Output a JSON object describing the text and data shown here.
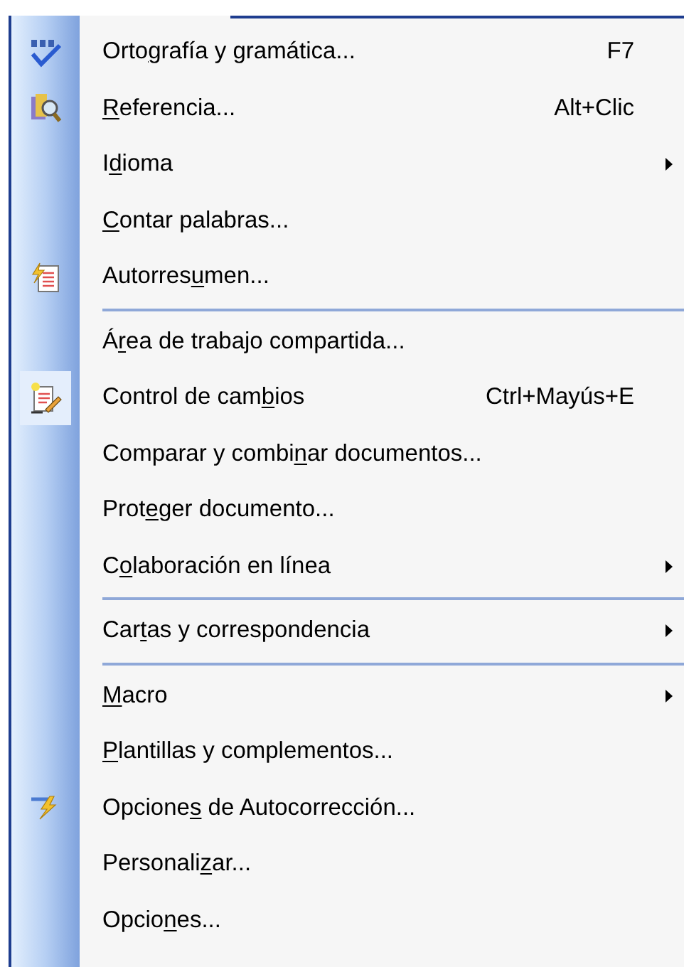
{
  "menu": {
    "items": [
      {
        "kind": "item",
        "label": {
          "pre": "Orto",
          "key": "g",
          "post": "rafía y gramática..."
        },
        "shortcut": "F7",
        "submenu": false,
        "checked": false
      },
      {
        "kind": "item",
        "label": {
          "key": "R",
          "post": "eferencia..."
        },
        "shortcut": "Alt+Clic",
        "submenu": false,
        "checked": false
      },
      {
        "kind": "item",
        "label": {
          "pre": "I",
          "key": "d",
          "post": "ioma"
        },
        "submenu": true,
        "checked": false
      },
      {
        "kind": "item",
        "label": {
          "key": "C",
          "post": "ontar palabras..."
        },
        "submenu": false,
        "checked": false
      },
      {
        "kind": "item",
        "label": {
          "pre": "Autorres",
          "key": "u",
          "post": "men..."
        },
        "submenu": false,
        "checked": false
      },
      {
        "kind": "separator"
      },
      {
        "kind": "item",
        "label": {
          "pre": "Á",
          "key": "r",
          "post": "ea de trabajo compartida..."
        },
        "submenu": false,
        "checked": false
      },
      {
        "kind": "item",
        "label": {
          "pre": "Control de cam",
          "key": "b",
          "post": "ios"
        },
        "shortcut": "Ctrl+Mayús+E",
        "submenu": false,
        "checked": true
      },
      {
        "kind": "item",
        "label": {
          "pre": "Comparar y combi",
          "key": "n",
          "post": "ar documentos..."
        },
        "submenu": false,
        "checked": false
      },
      {
        "kind": "item",
        "label": {
          "pre": "Prot",
          "key": "e",
          "post": "ger documento..."
        },
        "submenu": false,
        "checked": false
      },
      {
        "kind": "item",
        "label": {
          "pre": "C",
          "key": "o",
          "post": "laboración en línea"
        },
        "submenu": true,
        "checked": false
      },
      {
        "kind": "separator"
      },
      {
        "kind": "item",
        "label": {
          "pre": "Car",
          "key": "t",
          "post": "as y correspondencia"
        },
        "submenu": true,
        "checked": false
      },
      {
        "kind": "separator"
      },
      {
        "kind": "item",
        "label": {
          "key": "M",
          "post": "acro"
        },
        "submenu": true,
        "checked": false
      },
      {
        "kind": "item",
        "label": {
          "key": "P",
          "post": "lantillas y complementos..."
        },
        "submenu": false,
        "checked": false
      },
      {
        "kind": "item",
        "label": {
          "pre": "Opcione",
          "key": "s",
          "post": " de Autocorrección..."
        },
        "submenu": false,
        "checked": false
      },
      {
        "kind": "item",
        "label": {
          "pre": "Personali",
          "key": "z",
          "post": "ar..."
        },
        "submenu": false,
        "checked": false
      },
      {
        "kind": "item",
        "label": {
          "pre": "Opcio",
          "key": "n",
          "post": "es..."
        },
        "submenu": false,
        "checked": false
      }
    ]
  }
}
